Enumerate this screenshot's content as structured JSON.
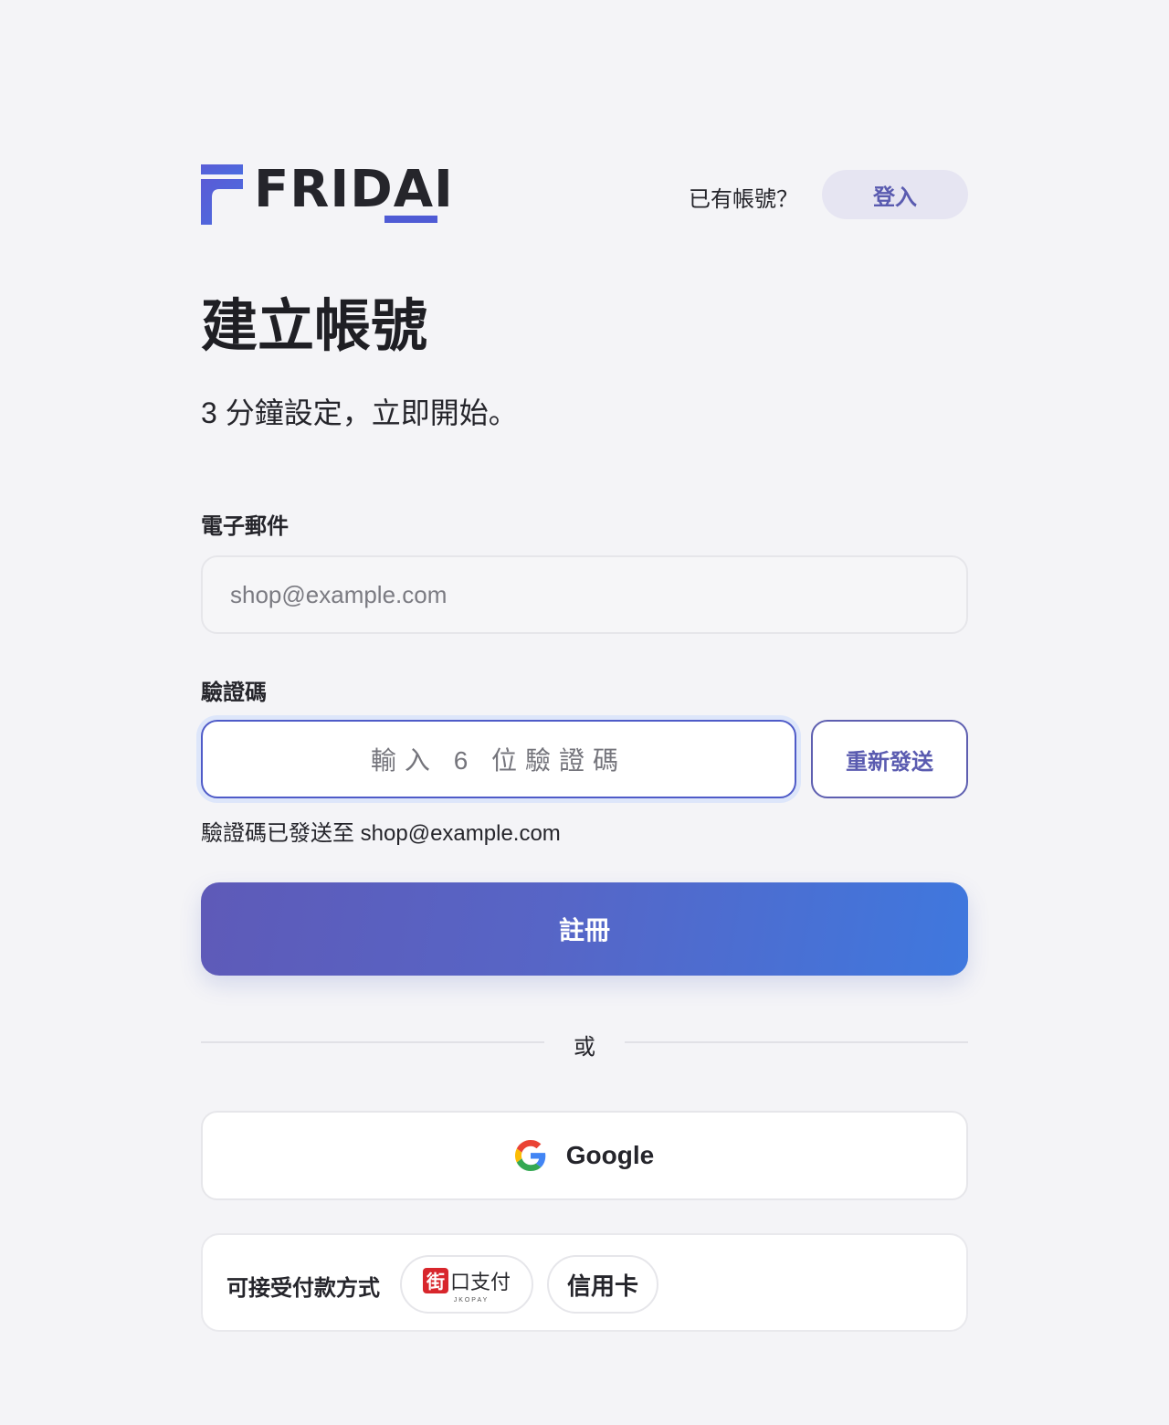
{
  "brand": {
    "logo_text": "FRIDAI",
    "colors": {
      "primary": "#5a5bb0",
      "accent": "#4f5bd5",
      "gradient_start": "#5e5ab8",
      "gradient_end": "#3f78de"
    }
  },
  "header": {
    "have_account_text": "已有帳號？",
    "login_label": "登入"
  },
  "main": {
    "title": "建立帳號",
    "subtitle": "3 分鐘設定，立即開始。"
  },
  "form": {
    "email": {
      "label": "電子郵件",
      "placeholder": "shop@example.com"
    },
    "code": {
      "label": "驗證碼",
      "placeholder": "輸入 6 位驗證碼",
      "resend_label": "重新發送",
      "hint": "驗證碼已發送至 shop@example.com"
    },
    "submit_label": "註冊"
  },
  "divider": {
    "text": "或"
  },
  "social": {
    "google_label": "Google",
    "icon": "google-icon"
  },
  "payments": {
    "label": "可接受付款方式",
    "methods": [
      {
        "name": "jkopay",
        "icon_char": "街",
        "title": "口支付",
        "sub": "JKOPAY"
      },
      {
        "name": "credit-card",
        "title": "信用卡"
      }
    ]
  }
}
